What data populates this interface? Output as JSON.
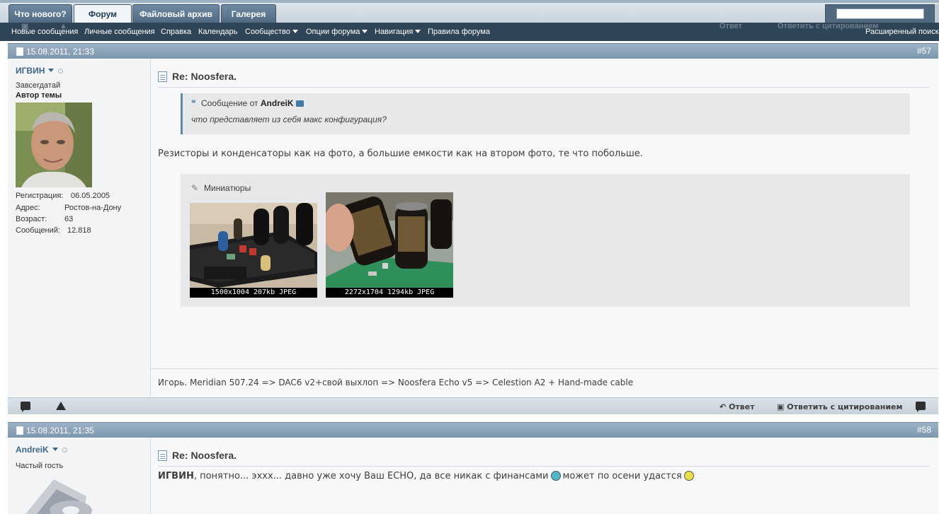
{
  "tabs": [
    {
      "label": "Что нового?",
      "active": false
    },
    {
      "label": "Форум",
      "active": true
    },
    {
      "label": "Файловый архив",
      "active": false
    },
    {
      "label": "Галерея",
      "active": false
    }
  ],
  "search": {
    "value": ""
  },
  "nav": {
    "items": [
      {
        "label": "Новые сообщения"
      },
      {
        "label": "Личные сообщения"
      },
      {
        "label": "Справка"
      },
      {
        "label": "Календарь"
      },
      {
        "label": "Сообщество"
      },
      {
        "label": "Опции форума"
      },
      {
        "label": "Навигация"
      },
      {
        "label": "Правила форума"
      }
    ],
    "advanced_search": "Расширенный поиск"
  },
  "posts": [
    {
      "date": "15.08.2011, 21:33",
      "number": "#57",
      "author": {
        "name": "ИГВИН",
        "title": "Завсегдатай",
        "rank": "Автор темы",
        "details": [
          {
            "label": "Регистрация:",
            "value": "06.05.2005"
          },
          {
            "label": "Адрес:",
            "value": "Ростов-на-Дону"
          },
          {
            "label": "Возраст:",
            "value": "63"
          },
          {
            "label": "Сообщений:",
            "value": "12.818"
          }
        ]
      },
      "title": "Re: Noosfera.",
      "quote": {
        "prefix": "Сообщение от",
        "author": "AndreiK",
        "text": "что представляет из себя макс конфигурация?"
      },
      "text": "Резисторы и конденсаторы как на фото, а большие емкости как на втором фото, те что побольше.",
      "attachments": {
        "label": "Миниатюры",
        "items": [
          {
            "caption": "1500x1004 207kb JPEG"
          },
          {
            "caption": "2272x1704 1294kb JPEG"
          }
        ]
      },
      "signature": "Игорь. Meridian 507.24 => DAC6 v2+свой выхлоп => Noosfera Echo v5 => Celestion A2 + Hand-made cable",
      "actions": {
        "reply": "Ответ",
        "quote_reply": "Ответить с цитированием"
      }
    },
    {
      "date": "15.08.2011, 21:35",
      "number": "#58",
      "author": {
        "name": "AndreiK",
        "title": "Частый гость"
      },
      "title": "Re: Noosfera.",
      "text_bold": "ИГВИН",
      "text_part1": ", понятно... эххх... давно уже хочу Ваш ECHO, да все никак с финансами",
      "text_part2": "может по осени удастся"
    }
  ],
  "ghost_actions": {
    "reply": "Ответ",
    "quote_reply": "Ответить с цитированием"
  },
  "colors": {
    "accent": "#3e6788",
    "header": "#7d97ae",
    "navbar": "#2f4557"
  }
}
